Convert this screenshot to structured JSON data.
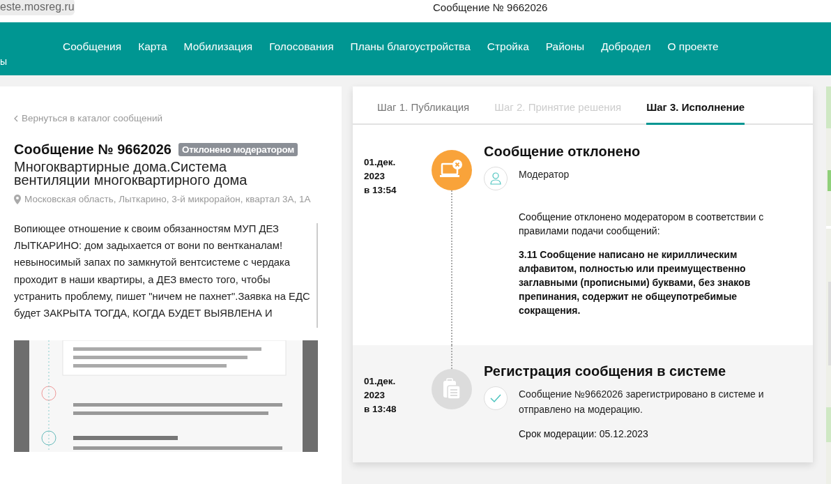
{
  "browser": {
    "url": "este.mosreg.ru",
    "title": "Сообщение № 9662026"
  },
  "nav": {
    "logo_fragment": "ы",
    "items": [
      "Сообщения",
      "Карта",
      "Мобилизация",
      "Голосования",
      "Планы благоустройства",
      "Стройка",
      "Районы",
      "Добродел",
      "О проекте"
    ]
  },
  "message": {
    "back_link": "Вернуться в каталог сообщений",
    "title": "Сообщение № 9662026",
    "status": "Отклонено модератором",
    "category": "Многоквартирные дома.Система вентиляции многоквартирного дома",
    "address": "Московская область, Лыткарино, 3-й микрорайон, квартал 3А, 1А",
    "body": "Вопиющее отношение к своим обязанностям МУП ДЕЗ ЛЫТКАРИНО: дом задыхается от вони по вентканалам! невыносимый запах по замкнутой вентсистеме с чердака проходит в наши квартиры, а ДЕЗ вместо того, чтобы устранить проблему, пишет \"ничем не пахнет\".Заявка на ЕДС будет ЗАКРЫТА ТОГДА, КОГДА БУДЕТ ВЫЯВЛЕНА И"
  },
  "steps": [
    {
      "label": "Шаг 1. Публикация",
      "selected": false,
      "disabled": false
    },
    {
      "label": "Шаг 2. Принятие решения",
      "selected": false,
      "disabled": true
    },
    {
      "label": "Шаг 3. Исполнение",
      "selected": true,
      "disabled": false
    }
  ],
  "events": [
    {
      "kind": "rejected",
      "date_lines": [
        "01.дек.",
        "2023",
        "в 13:54"
      ],
      "title": "Сообщение отклонено",
      "note": {
        "text": "Модератор"
      },
      "paragraphs": [
        {
          "text": "Сообщение отклонено модератором в соответствии с правилами подачи сообщений:",
          "bold": false
        },
        {
          "text": "3.11 Сообщение написано не кириллическим алфавитом, полностью или преимущественно заглавными (прописными) буквами, без знаков препинания, содержит не общеупотребимые сокращения.",
          "bold": true
        }
      ]
    },
    {
      "kind": "registered",
      "date_lines": [
        "01.дек.",
        "2023",
        "в 13:48"
      ],
      "title": "Регистрация сообщения в системе",
      "note": {
        "text": "Сообщение №9662026 зарегистрировано в системе и отправлено на модерацию."
      },
      "paragraphs": [
        {
          "text": "Срок модерации: 05.12.2023",
          "bold": false
        }
      ]
    }
  ]
}
